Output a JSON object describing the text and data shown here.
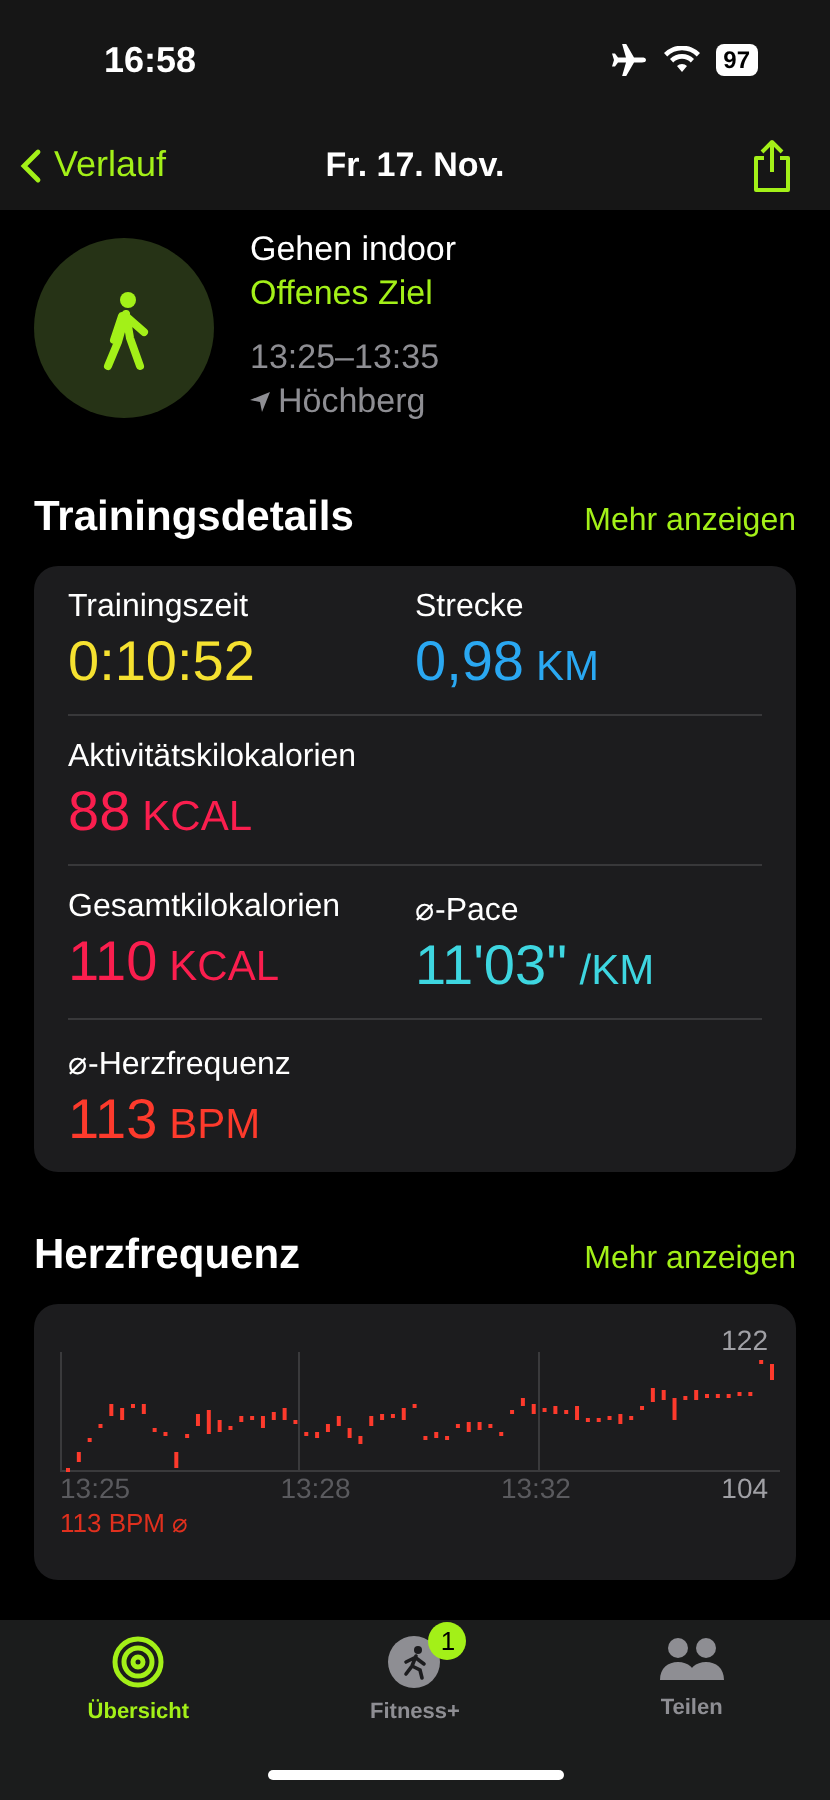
{
  "status_bar": {
    "time": "16:58",
    "battery": "97"
  },
  "nav": {
    "back": "Verlauf",
    "title": "Fr. 17. Nov."
  },
  "workout": {
    "name": "Gehen indoor",
    "goal": "Offenes Ziel",
    "time": "13:25–13:35",
    "location": "Höchberg"
  },
  "details": {
    "title": "Trainingsdetails",
    "more": "Mehr anzeigen",
    "rows": [
      [
        {
          "label": "Trainingszeit",
          "value": "0:10:52",
          "color": "#f5e130"
        },
        {
          "label": "Strecke",
          "value": "0,98",
          "unit": "KM",
          "color": "#2aa8f2"
        }
      ],
      [
        {
          "label": "Aktivitätskilokalorien",
          "value": "88",
          "unit": "KCAL",
          "color": "#fa1e4e"
        }
      ],
      [
        {
          "label": "Gesamtkilokalorien",
          "value": "110",
          "unit": "KCAL",
          "color": "#fa1e4e"
        },
        {
          "label": "⌀-Pace",
          "value": "11'03''",
          "unit": "/KM",
          "color": "#3ed6e0"
        }
      ],
      [
        {
          "label": "⌀-Herzfrequenz",
          "value": "113",
          "unit": "BPM",
          "color": "#fd3a2c"
        }
      ]
    ]
  },
  "heart_rate": {
    "title": "Herzfrequenz",
    "more": "Mehr anzeigen",
    "max": "122",
    "min": "104",
    "times": [
      "13:25",
      "13:28",
      "13:32"
    ],
    "average": "113 BPM ⌀"
  },
  "tab_bar": [
    {
      "label": "Übersicht",
      "selected": true
    },
    {
      "label": "Fitness+",
      "selected": false,
      "badge": "1"
    },
    {
      "label": "Teilen",
      "selected": false
    }
  ]
}
